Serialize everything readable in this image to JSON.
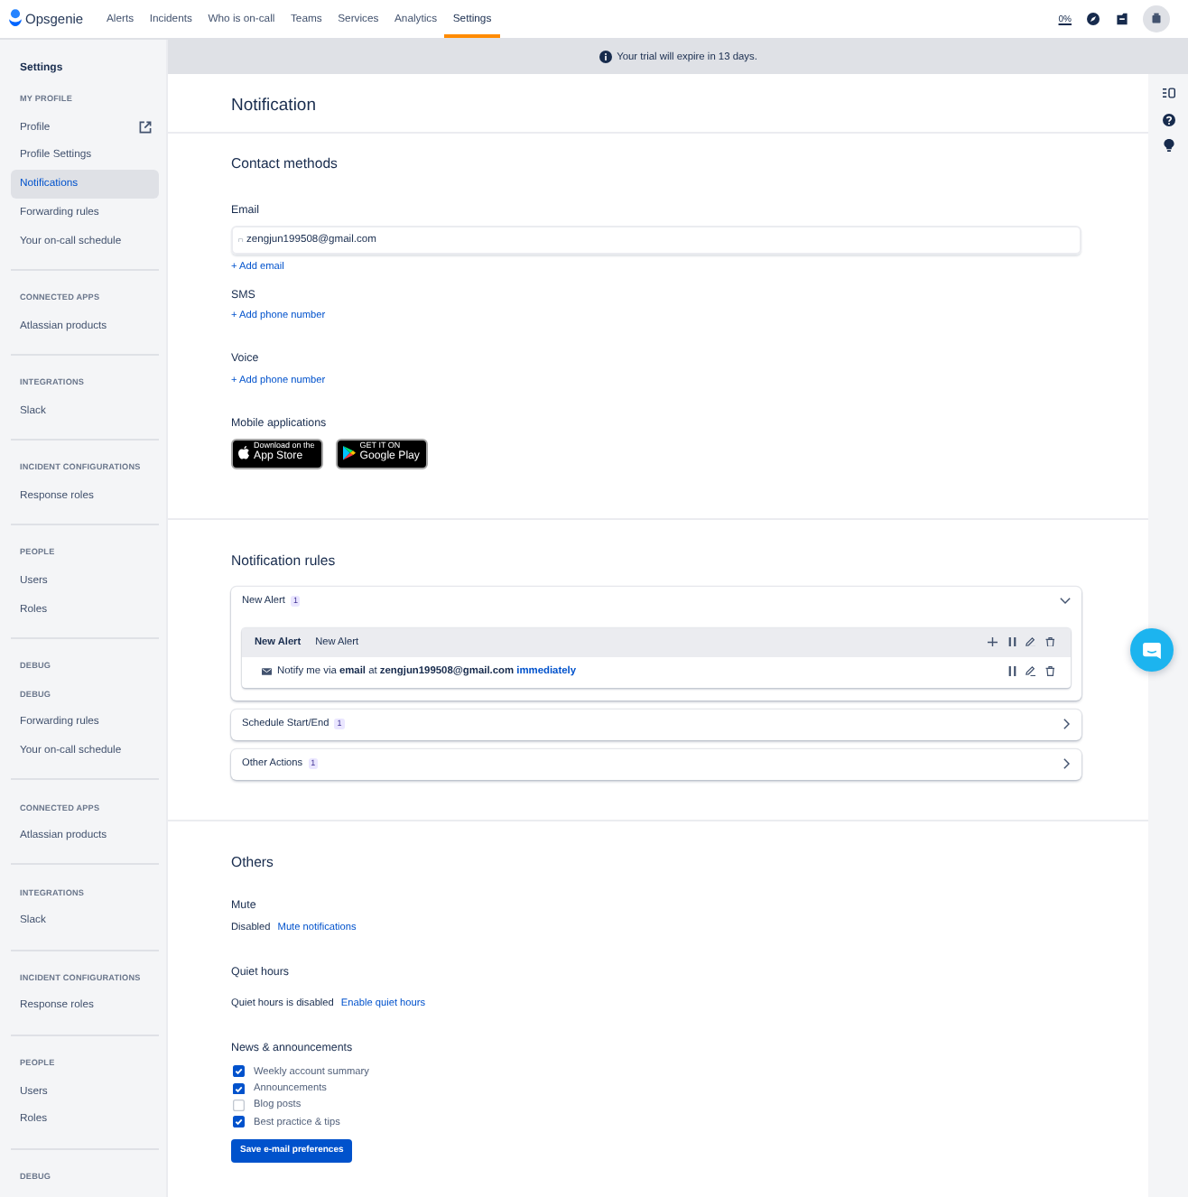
{
  "topbar": {
    "logo": "Opsgenie",
    "nav": [
      {
        "label": "Alerts",
        "selected": false
      },
      {
        "label": "Incidents",
        "selected": false
      },
      {
        "label": "Who is on-call",
        "selected": false
      },
      {
        "label": "Teams",
        "selected": false
      },
      {
        "label": "Services",
        "selected": false
      },
      {
        "label": "Analytics",
        "selected": false
      },
      {
        "label": "Settings",
        "selected": true
      }
    ],
    "usage": "0%"
  },
  "banner": {
    "text": "Your trial will expire in 13 days."
  },
  "sidebar": {
    "title": "Settings",
    "sections": [
      {
        "heading": "MY PROFILE",
        "items": [
          {
            "label": "Profile",
            "kind": "external",
            "selected": false
          },
          {
            "label": "Profile Settings",
            "kind": "link",
            "selected": false
          },
          {
            "label": "Notifications",
            "kind": "link",
            "selected": true
          },
          {
            "label": "Forwarding rules",
            "kind": "link",
            "selected": false
          },
          {
            "label": "Your on-call schedule",
            "kind": "link",
            "selected": false
          }
        ]
      },
      {
        "heading": "CONNECTED APPS",
        "items": [
          {
            "label": "Atlassian products",
            "kind": "link",
            "selected": false
          }
        ]
      },
      {
        "heading": "INTEGRATIONS",
        "items": [
          {
            "label": "Slack",
            "kind": "link",
            "selected": false
          }
        ]
      },
      {
        "heading": "INCIDENT CONFIGURATIONS",
        "items": [
          {
            "label": "Response roles",
            "kind": "link",
            "selected": false
          }
        ]
      },
      {
        "heading": "PEOPLE",
        "items": [
          {
            "label": "Users",
            "kind": "link",
            "selected": false
          },
          {
            "label": "Roles",
            "kind": "link",
            "selected": false
          }
        ]
      },
      {
        "heading": "DEBUG",
        "items": [
          {
            "label": "DEBUG",
            "kind": "caption",
            "selected": false
          },
          {
            "label": "Forwarding rules",
            "kind": "link",
            "selected": false
          },
          {
            "label": "Your on-call schedule",
            "kind": "link",
            "selected": false
          }
        ]
      },
      {
        "heading": "CONNECTED APPS",
        "items": [
          {
            "label": "Atlassian products",
            "kind": "link",
            "selected": false
          }
        ]
      },
      {
        "heading": "INTEGRATIONS",
        "items": [
          {
            "label": "Slack",
            "kind": "link",
            "selected": false
          }
        ]
      },
      {
        "heading": "INCIDENT CONFIGURATIONS",
        "items": [
          {
            "label": "Response roles",
            "kind": "link",
            "selected": false
          }
        ]
      },
      {
        "heading": "PEOPLE",
        "items": [
          {
            "label": "Users",
            "kind": "link",
            "selected": false
          },
          {
            "label": "Roles",
            "kind": "link",
            "selected": false
          }
        ]
      },
      {
        "heading": "DEBUG"
      }
    ]
  },
  "page": {
    "title": "Notification"
  },
  "contact_methods": {
    "title": "Contact methods",
    "groups": [
      {
        "label": "Email",
        "value": "zengjun199508@gmail.com",
        "add": "+ Add email"
      },
      {
        "label": "SMS",
        "add": "+ Add phone number"
      },
      {
        "label": "Voice",
        "add": "+ Add phone number"
      }
    ],
    "mobile": {
      "label": "Mobile applications",
      "stores": [
        {
          "kind": "apple",
          "caption": "Download on the",
          "name": "App Store"
        },
        {
          "kind": "google",
          "caption": "GET IT ON",
          "name": "Google Play"
        }
      ]
    }
  },
  "notification_rules": {
    "title": "Notification rules",
    "groups": [
      {
        "name": "New Alert",
        "count": "1",
        "expanded": true,
        "rules": [
          {
            "title": "New Alert",
            "subtitle": "New Alert",
            "steps": [
              {
                "text": "Notify me via **email** at **zengjun199508@gmail.com**",
                "timing": "immediately"
              }
            ]
          }
        ]
      },
      {
        "name": "Schedule Start/End",
        "count": "1",
        "expanded": false
      },
      {
        "name": "Other Actions",
        "count": "1",
        "expanded": false
      }
    ]
  },
  "others": {
    "title": "Others",
    "mute": {
      "title": "Mute",
      "status": "Disabled",
      "action": "Mute notifications"
    },
    "quiet_hours": {
      "title": "Quiet hours",
      "status": "Quiet hours is disabled",
      "action": "Enable quiet hours"
    },
    "news": {
      "title": "News & announcements",
      "options": [
        {
          "label": "Weekly account summary",
          "checked": true
        },
        {
          "label": "Announcements",
          "checked": true
        },
        {
          "label": "Blog posts",
          "checked": false
        },
        {
          "label": "Best practice & tips",
          "checked": true
        }
      ],
      "button": "Save e-mail preferences"
    }
  }
}
